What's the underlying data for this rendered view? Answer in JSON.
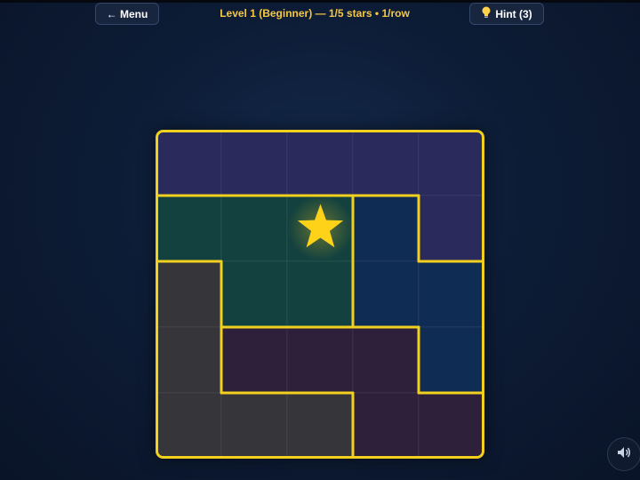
{
  "header": {
    "menu_label": "← Menu",
    "level_text": "Level 1 (Beginner) — 1/5 stars • 1/row",
    "hint_label": "Hint (3)"
  },
  "icons": {
    "menu": "left-arrow",
    "hint": "lightbulb-icon",
    "sound": "speaker-icon",
    "star": "star-icon"
  },
  "colors": {
    "region_border": "#f2d01e",
    "star": "#ffd21a"
  },
  "board": {
    "rows": 5,
    "cols": 5,
    "regions": [
      [
        0,
        0,
        0,
        0,
        0
      ],
      [
        1,
        1,
        1,
        2,
        0
      ],
      [
        3,
        1,
        1,
        2,
        2
      ],
      [
        3,
        4,
        4,
        4,
        2
      ],
      [
        3,
        3,
        3,
        4,
        4
      ]
    ],
    "region_colors": [
      "#2a2a5c",
      "#13413f",
      "#0f2c55",
      "#36353a",
      "#2e1f3a"
    ],
    "stars": [
      [
        1,
        2
      ]
    ]
  }
}
